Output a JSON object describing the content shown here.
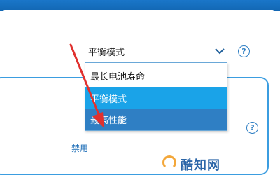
{
  "power_mode": {
    "selected_value": "平衡模式",
    "options": [
      "最长电池寿命",
      "平衡模式",
      "最高性能"
    ],
    "hovered_option": "平衡模式",
    "highlighted_option": "最高性能"
  },
  "help_icons": [
    "?",
    "?"
  ],
  "disable_link": "禁用",
  "watermark": "酷知网",
  "colors": {
    "accent": "#2f7fc4",
    "hover": "#1aa3e8",
    "arrow": "#e0312f",
    "titlebar": "#1a76c9"
  },
  "icons": {
    "dropdown_caret": "chevron-down-icon",
    "help": "question-circle-icon",
    "annotation": "red-arrow-icon"
  }
}
